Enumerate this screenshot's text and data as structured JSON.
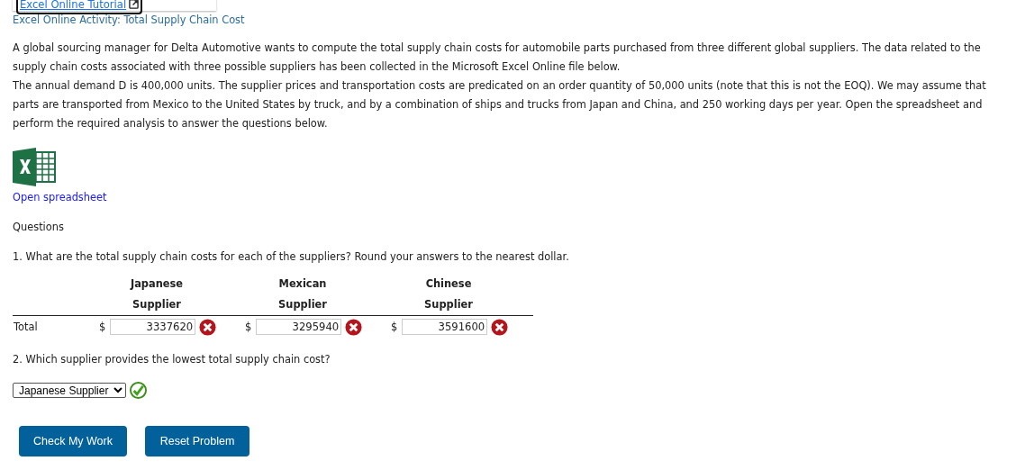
{
  "popup": {
    "link": "Excel Online Tutorial"
  },
  "activity_title": "Excel Online Activity: Total Supply Chain Cost",
  "paragraphs": [
    "A global sourcing manager for Delta Automotive wants to compute the total supply chain costs for automobile parts purchased from three different global suppliers. The data related to the supply chain costs associated with three possible suppliers has been collected in the Microsoft Excel Online file below.",
    "The annual demand D is 400,000 units. The supplier prices and transportation costs are predicated on an order quantity of 50,000 units (note that this is not the EOQ). We may assume that parts are transported from Mexico to the United States by truck, and by a combination of ships and trucks from Japan and China, and 250 working days per year. Open the spreadsheet and perform the required analysis to answer the questions below."
  ],
  "spreadsheet_link": "Open spreadsheet",
  "questions_heading": "Questions",
  "question_1": {
    "prompt": "1. What are the total supply chain costs for each of the suppliers? Round your answers to the nearest dollar.",
    "columns": [
      {
        "line_1": "Japanese",
        "line_2": "Supplier"
      },
      {
        "line_1": "Mexican",
        "line_2": "Supplier"
      },
      {
        "line_1": "Chinese",
        "line_2": "Supplier"
      }
    ],
    "row_label": "Total",
    "answers": [
      {
        "currency": "$",
        "value": "3337620",
        "correct": false
      },
      {
        "currency": "$",
        "value": "3295940",
        "correct": false
      },
      {
        "currency": "$",
        "value": "3591600",
        "correct": false
      }
    ]
  },
  "question_2": {
    "prompt": "2. Which supplier provides the lowest total supply chain cost?",
    "select": {
      "value": "Japanese Supplier",
      "correct": true
    }
  },
  "buttons": [
    "Check My Work",
    "Reset Problem"
  ]
}
